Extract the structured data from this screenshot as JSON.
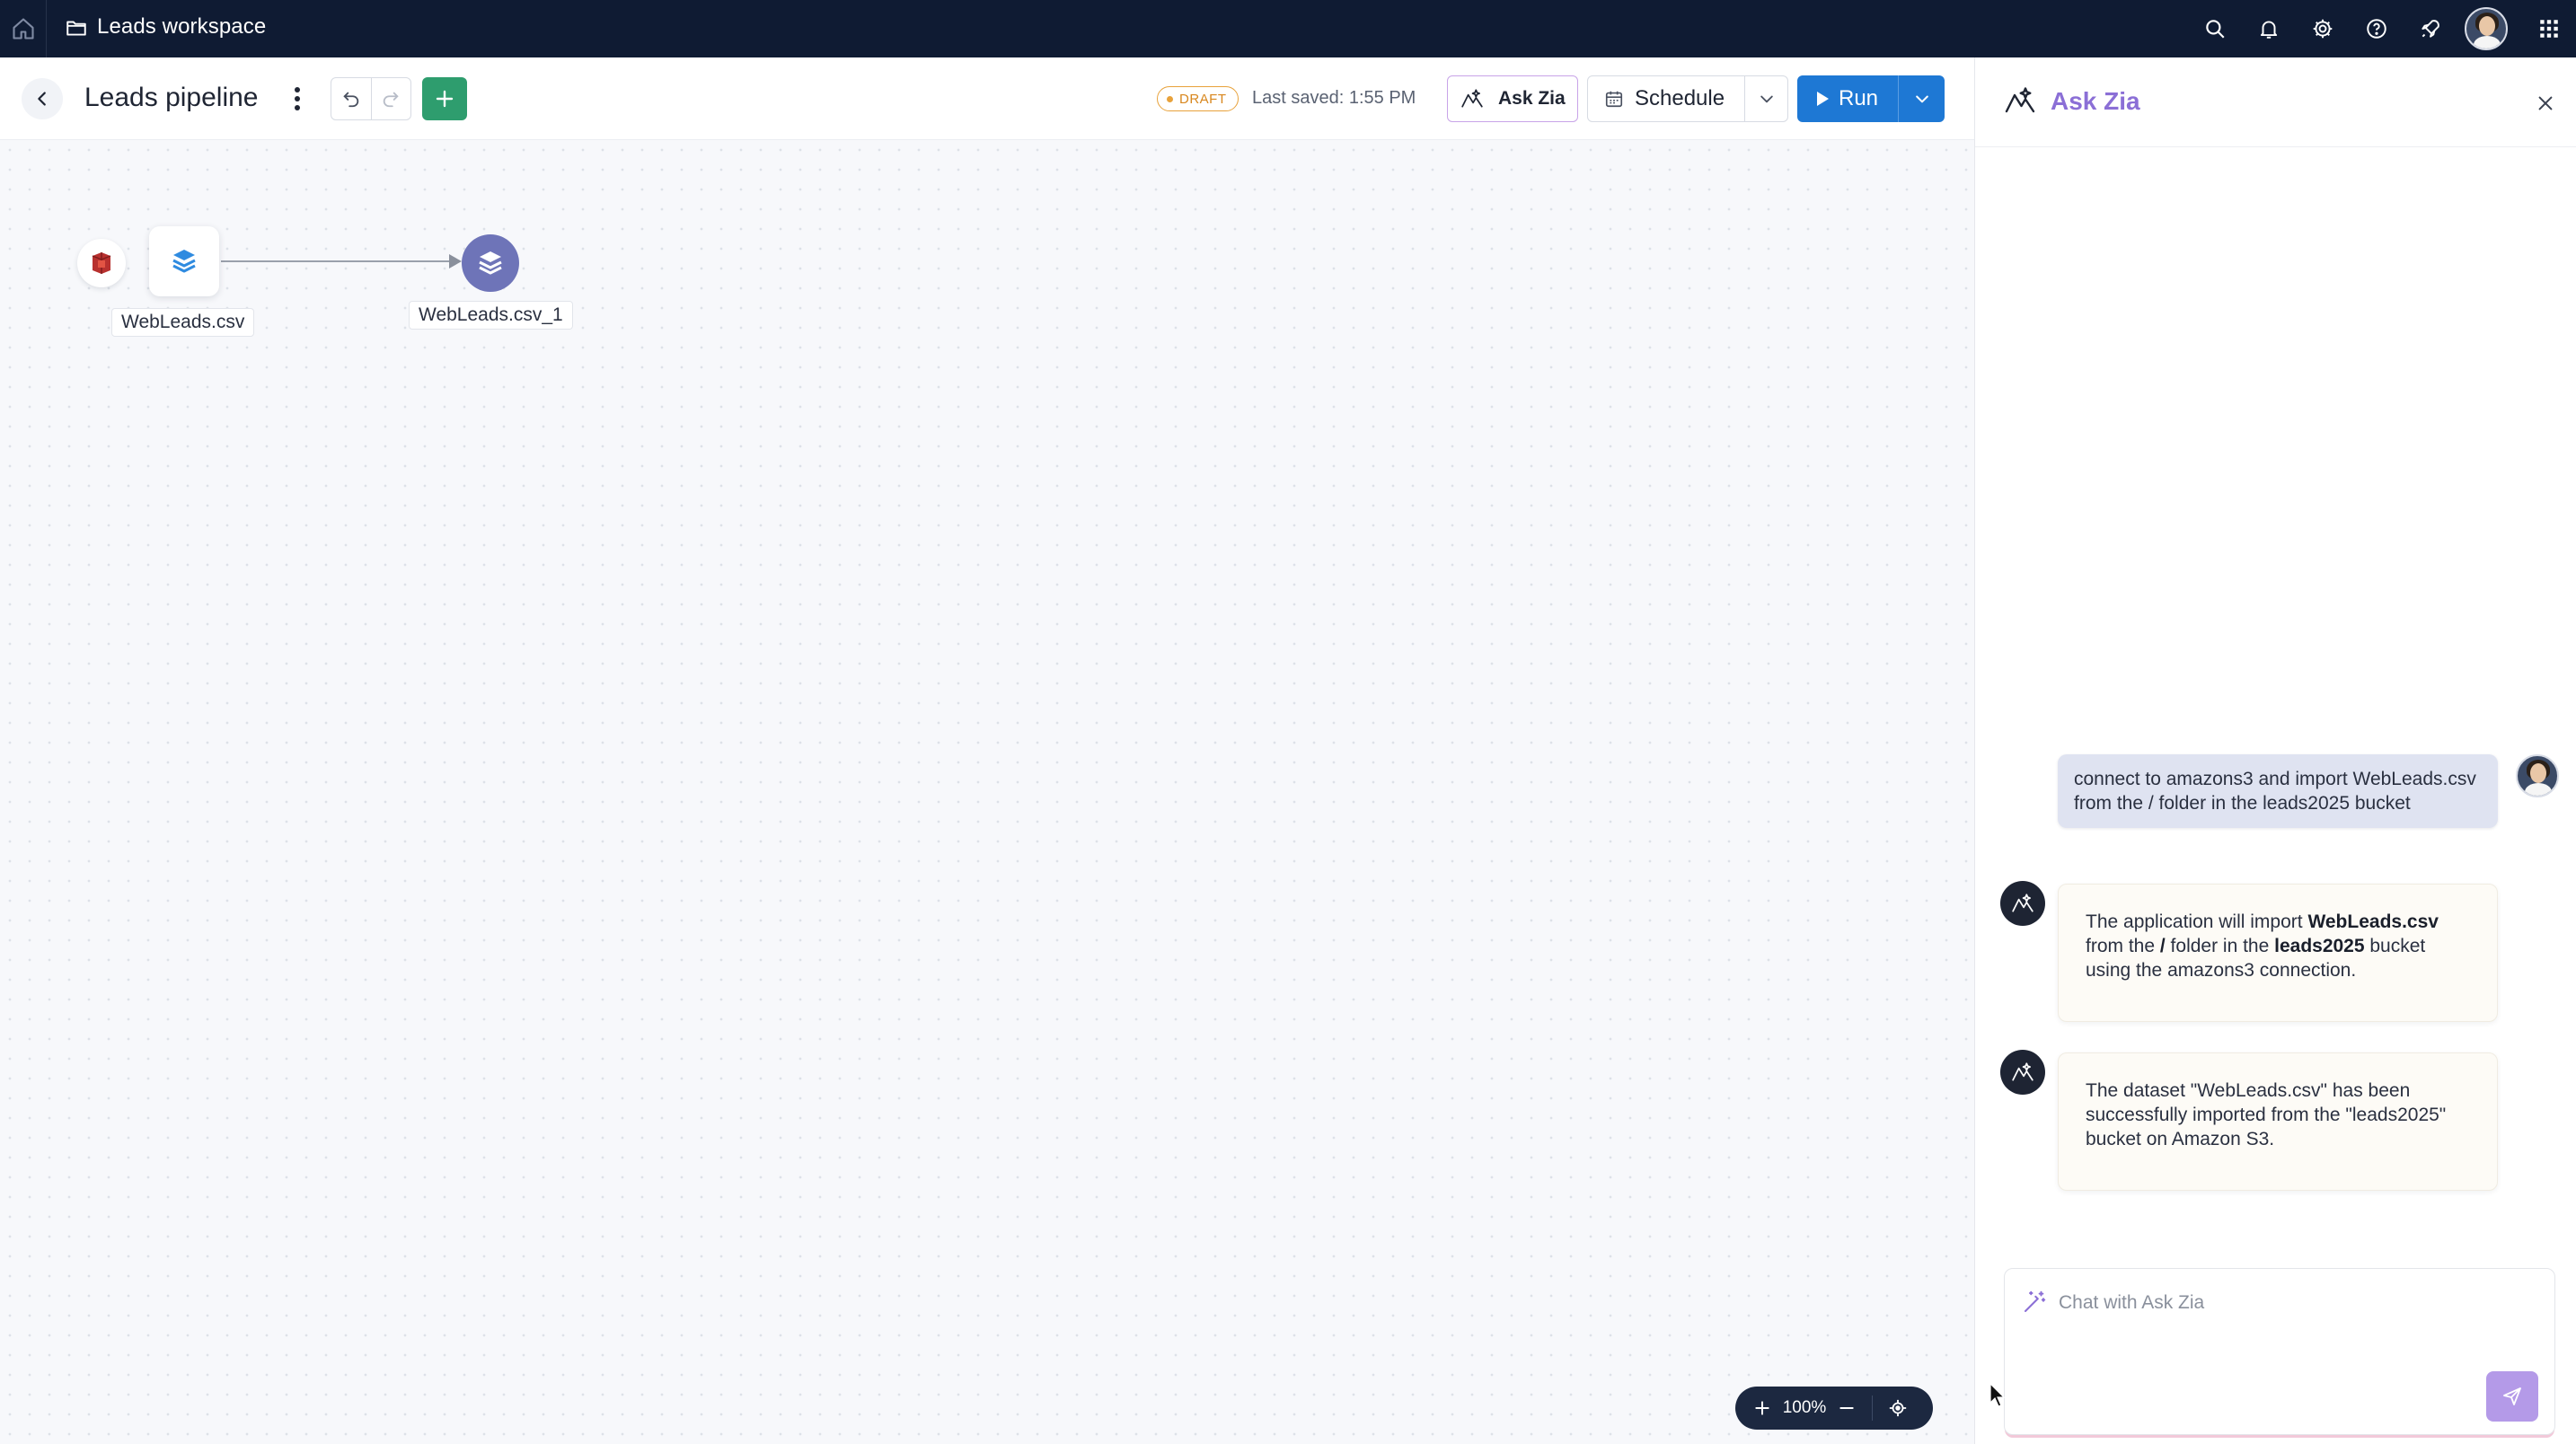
{
  "app": {
    "workspace_title": "Leads workspace"
  },
  "toolbar": {
    "page_title": "Leads pipeline",
    "status_badge": "DRAFT",
    "last_saved": "Last saved: 1:55 PM",
    "ask_zia_label": "Ask Zia",
    "schedule_label": "Schedule",
    "run_label": "Run"
  },
  "canvas": {
    "nodes": [
      {
        "label": "WebLeads.csv",
        "kind": "source",
        "icon": "layers-icon"
      },
      {
        "label": "WebLeads.csv_1",
        "kind": "dataset",
        "icon": "layers-icon"
      }
    ],
    "zoom": "100%"
  },
  "panel": {
    "title": "Ask Zia",
    "messages": [
      {
        "role": "user",
        "text": "connect to amazons3 and import WebLeads.csv from the / folder in the leads2025 bucket"
      },
      {
        "role": "assistant",
        "parts": {
          "p1": "The application will import ",
          "b1": "WebLeads.csv",
          "p2": " from the ",
          "b2": "/",
          "p3": " folder in the ",
          "b3": "leads2025",
          "p4": " bucket using the amazons3 connection."
        }
      },
      {
        "role": "assistant",
        "text": "The dataset \"WebLeads.csv\" has been successfully imported from the \"leads2025\" bucket on Amazon S3."
      }
    ],
    "chat_placeholder": "Chat with Ask Zia"
  },
  "colors": {
    "topbar_bg": "#0f1b33",
    "accent_purple": "#8b6fd6",
    "run_blue": "#1e78d4",
    "add_green": "#2e9d6e",
    "draft_orange": "#e8a23b"
  }
}
